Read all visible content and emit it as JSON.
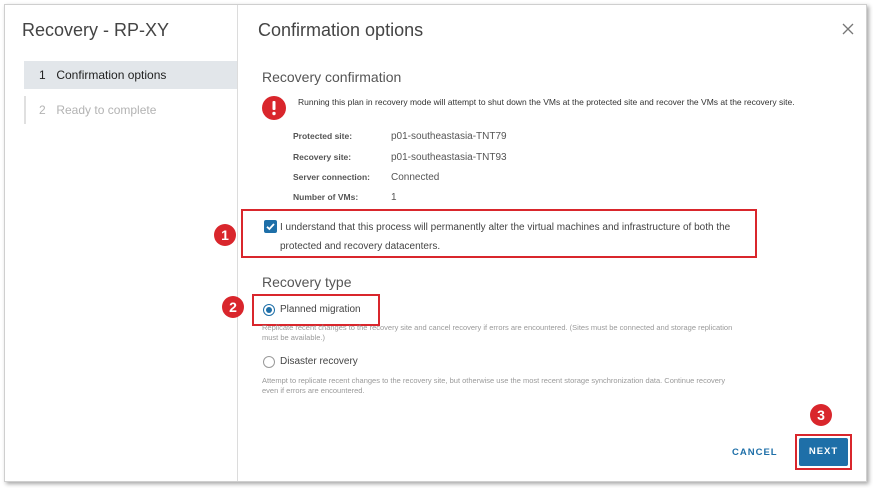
{
  "wizard": {
    "title": "Recovery - RP-XY",
    "steps": [
      {
        "num": "1",
        "label": "Confirmation options"
      },
      {
        "num": "2",
        "label": "Ready to complete"
      }
    ]
  },
  "page": {
    "title": "Confirmation options",
    "recovery_confirmation": {
      "heading": "Recovery confirmation",
      "warning": "Running this plan in recovery mode will attempt to shut down the VMs at the protected site and recover the VMs at the recovery site.",
      "details": [
        {
          "key": "Protected site:",
          "value": "p01-southeastasia-TNT79"
        },
        {
          "key": "Recovery site:",
          "value": "p01-southeastasia-TNT93"
        },
        {
          "key": "Server connection:",
          "value": "Connected"
        },
        {
          "key": "Number of VMs:",
          "value": "1"
        }
      ],
      "confirm_checkbox": {
        "checked": true,
        "label": "I understand that this process will permanently alter the virtual machines and infrastructure of both the protected and recovery datacenters."
      }
    },
    "recovery_type": {
      "heading": "Recovery type",
      "options": [
        {
          "label": "Planned migration",
          "selected": true,
          "description": "Replicate recent changes to the recovery site and cancel recovery if errors are encountered. (Sites must be connected and storage replication must be available.)"
        },
        {
          "label": "Disaster recovery",
          "selected": false,
          "description": "Attempt to replicate recent changes to the recovery site, but otherwise use the most recent storage synchronization data. Continue recovery even if errors are encountered."
        }
      ]
    }
  },
  "footer": {
    "cancel_label": "CANCEL",
    "next_label": "NEXT"
  },
  "callouts": [
    "1",
    "2",
    "3"
  ],
  "colors": {
    "accent": "#1e6fa8",
    "highlight_red": "#d9262c",
    "error_red": "#d9262c"
  },
  "icons": {
    "close": "close-icon",
    "warning": "error-circle-icon",
    "check": "check-icon"
  }
}
